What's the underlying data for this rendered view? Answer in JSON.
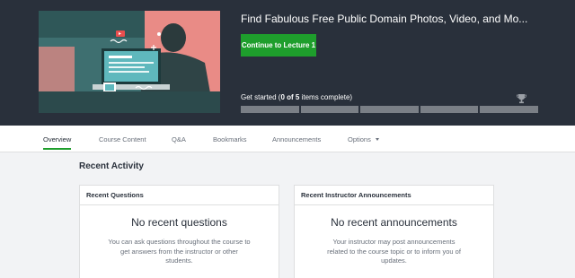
{
  "course": {
    "title": "Find Fabulous Free Public Domain Photos, Video, and Mo...",
    "cta_label": "Continue to Lecture 1",
    "progress": {
      "prefix": "Get started (",
      "completed": "0",
      "of_word": " of ",
      "total": "5",
      "suffix": " items complete)",
      "fraction": 0
    }
  },
  "tabs": [
    {
      "label": "Overview",
      "active": true
    },
    {
      "label": "Course Content"
    },
    {
      "label": "Q&A"
    },
    {
      "label": "Bookmarks"
    },
    {
      "label": "Announcements"
    },
    {
      "label": "Options",
      "has_dropdown": true
    }
  ],
  "recent_activity": {
    "title": "Recent Activity",
    "questions": {
      "header": "Recent Questions",
      "empty_title": "No recent questions",
      "description": "You can ask questions throughout the course to get answers from the instructor or other students."
    },
    "announcements": {
      "header": "Recent Instructor Announcements",
      "empty_title": "No recent announcements",
      "description": "Your instructor may post announcements related to the course topic or to inform you of updates."
    }
  },
  "colors": {
    "accent": "#1e9e2c",
    "header_bg": "#29303b",
    "page_bg": "#f2f3f5"
  }
}
